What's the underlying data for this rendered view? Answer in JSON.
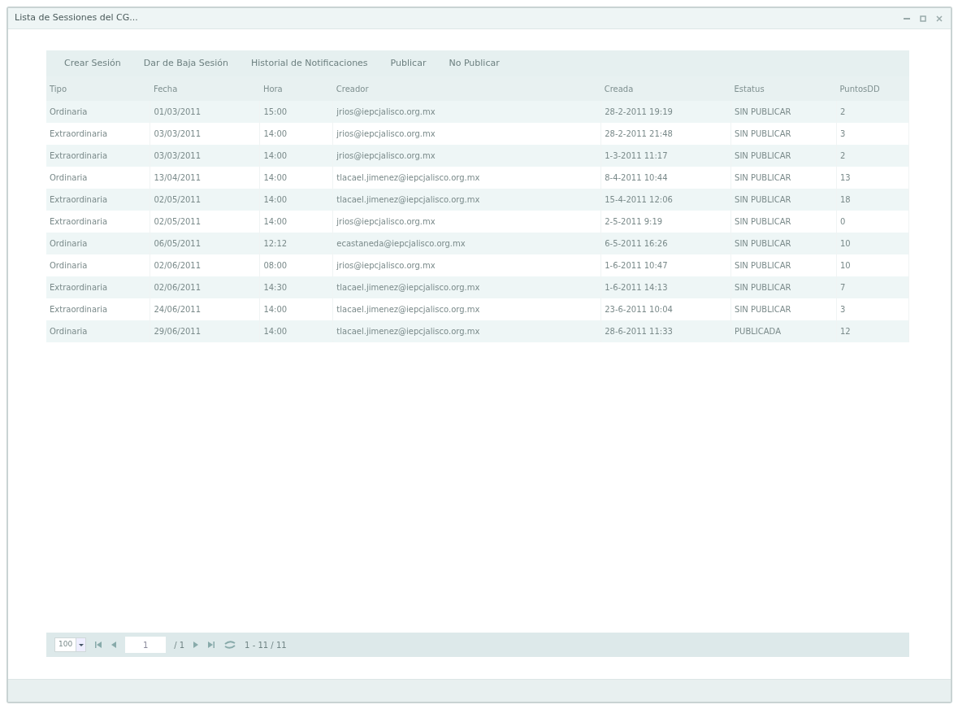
{
  "window": {
    "title": "Lista de Sessiones del CG..."
  },
  "toolbar": [
    "Crear Sesión",
    "Dar de Baja Sesión",
    "Historial de Notificaciones",
    "Publicar",
    "No Publicar"
  ],
  "table": {
    "columns": [
      "Tipo",
      "Fecha",
      "Hora",
      "Creador",
      "Creada",
      "Estatus",
      "PuntosDD"
    ],
    "rows": [
      [
        "Ordinaria",
        "01/03/2011",
        "15:00",
        "jrios@iepcjalisco.org.mx",
        "28-2-2011 19:19",
        "SIN PUBLICAR",
        "2"
      ],
      [
        "Extraordinaria",
        "03/03/2011",
        "14:00",
        "jrios@iepcjalisco.org.mx",
        "28-2-2011 21:48",
        "SIN PUBLICAR",
        "3"
      ],
      [
        "Extraordinaria",
        "03/03/2011",
        "14:00",
        "jrios@iepcjalisco.org.mx",
        "1-3-2011 11:17",
        "SIN PUBLICAR",
        "2"
      ],
      [
        "Ordinaria",
        "13/04/2011",
        "14:00",
        "tlacael.jimenez@iepcjalisco.org.mx",
        "8-4-2011 10:44",
        "SIN PUBLICAR",
        "13"
      ],
      [
        "Extraordinaria",
        "02/05/2011",
        "14:00",
        "tlacael.jimenez@iepcjalisco.org.mx",
        "15-4-2011 12:06",
        "SIN PUBLICAR",
        "18"
      ],
      [
        "Extraordinaria",
        "02/05/2011",
        "14:00",
        "jrios@iepcjalisco.org.mx",
        "2-5-2011 9:19",
        "SIN PUBLICAR",
        "0"
      ],
      [
        "Ordinaria",
        "06/05/2011",
        "12:12",
        "ecastaneda@iepcjalisco.org.mx",
        "6-5-2011 16:26",
        "SIN PUBLICAR",
        "10"
      ],
      [
        "Ordinaria",
        "02/06/2011",
        "08:00",
        "jrios@iepcjalisco.org.mx",
        "1-6-2011 10:47",
        "SIN PUBLICAR",
        "10"
      ],
      [
        "Extraordinaria",
        "02/06/2011",
        "14:30",
        "tlacael.jimenez@iepcjalisco.org.mx",
        "1-6-2011 14:13",
        "SIN PUBLICAR",
        "7"
      ],
      [
        "Extraordinaria",
        "24/06/2011",
        "14:00",
        "tlacael.jimenez@iepcjalisco.org.mx",
        "23-6-2011 10:04",
        "SIN PUBLICAR",
        "3"
      ],
      [
        "Ordinaria",
        "29/06/2011",
        "14:00",
        "tlacael.jimenez@iepcjalisco.org.mx",
        "28-6-2011 11:33",
        "PUBLICADA",
        "12"
      ]
    ]
  },
  "pager": {
    "page_size": "100",
    "page": "1",
    "page_count": "/ 1",
    "summary": "1 - 11 / 11"
  }
}
